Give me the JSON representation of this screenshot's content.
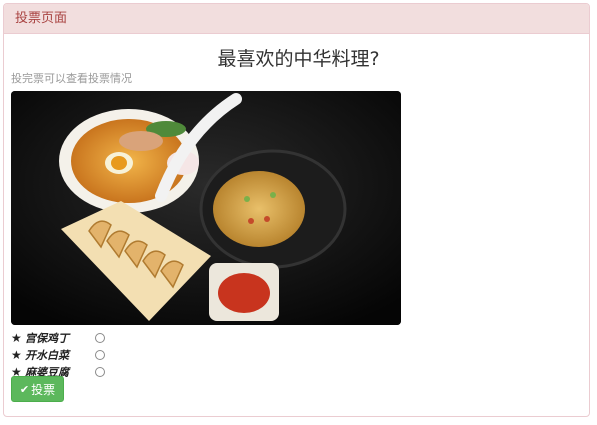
{
  "panel": {
    "heading": "投票页面"
  },
  "poll": {
    "title": "最喜欢的中华料理?",
    "subtitle": "投完票可以查看投票情况",
    "options": [
      {
        "label": "宫保鸡丁",
        "icon": "star-icon"
      },
      {
        "label": "开水白菜",
        "icon": "star-icon"
      },
      {
        "label": "麻婆豆腐",
        "icon": "star-icon"
      }
    ],
    "vote_label": "投票",
    "vote_icon": "check-icon"
  },
  "colors": {
    "heading_bg": "#f2dede",
    "heading_text": "#a94442",
    "button_bg": "#5cb85c"
  }
}
